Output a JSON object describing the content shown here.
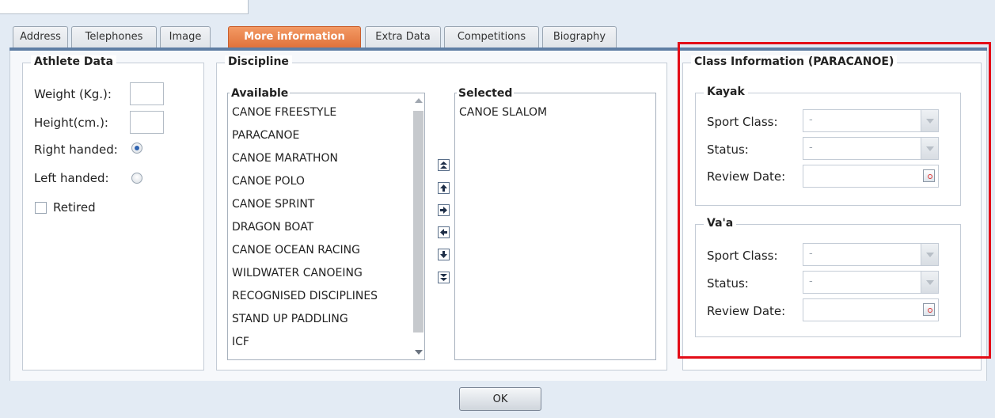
{
  "tabs": [
    {
      "label": "Address",
      "active": false
    },
    {
      "label": "Telephones",
      "active": false
    },
    {
      "label": "Image",
      "active": false
    },
    {
      "label": "More information",
      "active": true
    },
    {
      "label": "Extra Data",
      "active": false
    },
    {
      "label": "Competitions",
      "active": false
    },
    {
      "label": "Biography",
      "active": false
    }
  ],
  "athlete_data": {
    "legend": "Athlete Data",
    "weight_label": "Weight (Kg.):",
    "weight_value": "",
    "height_label": "Height(cm.):",
    "height_value": "",
    "right_handed_label": "Right handed:",
    "right_handed_selected": true,
    "left_handed_label": "Left handed:",
    "left_handed_selected": false,
    "retired_label": "Retired",
    "retired_checked": false
  },
  "discipline": {
    "legend": "Discipline",
    "available_label": "Available",
    "available": [
      "CANOE FREESTYLE",
      "PARACANOE",
      "CANOE MARATHON",
      "CANOE POLO",
      "CANOE SPRINT",
      "DRAGON BOAT",
      "CANOE OCEAN RACING",
      "WILDWATER CANOEING",
      "RECOGNISED DISCIPLINES",
      "STAND UP PADDLING",
      "ICF"
    ],
    "selected_label": "Selected",
    "selected": [
      "CANOE SLALOM"
    ],
    "move_buttons": [
      "move-top",
      "move-up",
      "move-right",
      "move-left",
      "move-down",
      "move-bottom"
    ]
  },
  "class_info": {
    "legend": "Class Information (PARACANOE)",
    "kayak": {
      "legend": "Kayak",
      "sport_class_label": "Sport Class:",
      "sport_class_value": "-",
      "status_label": "Status:",
      "status_value": "-",
      "review_date_label": "Review Date:",
      "review_date_value": ""
    },
    "vaa": {
      "legend": "Va'a",
      "sport_class_label": "Sport Class:",
      "sport_class_value": "-",
      "status_label": "Status:",
      "status_value": "-",
      "review_date_label": "Review Date:",
      "review_date_value": ""
    }
  },
  "footer": {
    "ok_label": "OK"
  },
  "colors": {
    "active_tab": "#e87d45",
    "tab_line": "#5f7ea4",
    "highlight": "#e30d17",
    "radio_selected": "#2f63b0"
  }
}
